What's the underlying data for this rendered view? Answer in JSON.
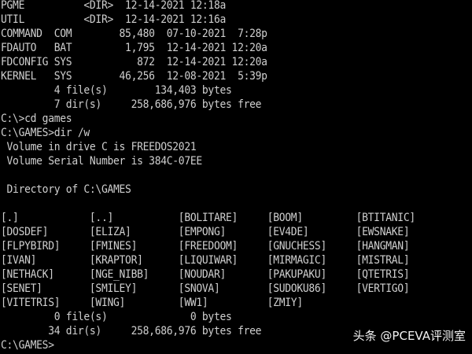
{
  "terminal": {
    "lines": [
      "PGME          <DIR>  12-14-2021 12:18a",
      "UTIL          <DIR>  12-14-2021 12:16a",
      "COMMAND  COM        85,480  07-10-2021  7:28p",
      "FDAUTO   BAT         1,795  12-14-2021 12:20a",
      "FDCONFIG SYS           872  12-14-2021 12:20a",
      "KERNEL   SYS        46,256  12-08-2021  5:39p",
      "         4 file(s)        134,403 bytes",
      "         7 dir(s)     258,686,976 bytes free",
      "C:\\>cd games",
      "C:\\GAMES>dir /w",
      " Volume in drive C is FREEDOS2021",
      " Volume Serial Number is 384C-07EE",
      "",
      " Directory of C:\\GAMES",
      "",
      "[.]            [..]           [BOLITARE]     [BOOM]         [BTITANIC]",
      "[DOSDEF]       [ELIZA]        [EMPONG]       [EV4DE]        [EWSNAKE]",
      "[FLPYBIRD]     [FMINES]       [FREEDOOM]     [GNUCHESS]     [HANGMAN]",
      "[IVAN]         [KRAPTOR]      [LIQUIWAR]     [MIRMAGIC]     [MISTRAL]",
      "[NETHACK]      [NGE_NIBB]     [NOUDAR]       [PAKUPAKU]     [QTETRIS]",
      "[SENET]        [SMILEY]       [SNOVA]        [SUDOKU86]     [VERTIGO]",
      "[VITETRIS]     [WING]         [WW1]          [ZMIY]",
      "         0 file(s)              0 bytes",
      "        34 dir(s)     258,686,976 bytes free",
      "C:\\GAMES>"
    ]
  },
  "watermark": {
    "text": "头条 @PCEVA评测室"
  },
  "colors": {
    "background": "#000000",
    "text": "#cfcfcf"
  }
}
